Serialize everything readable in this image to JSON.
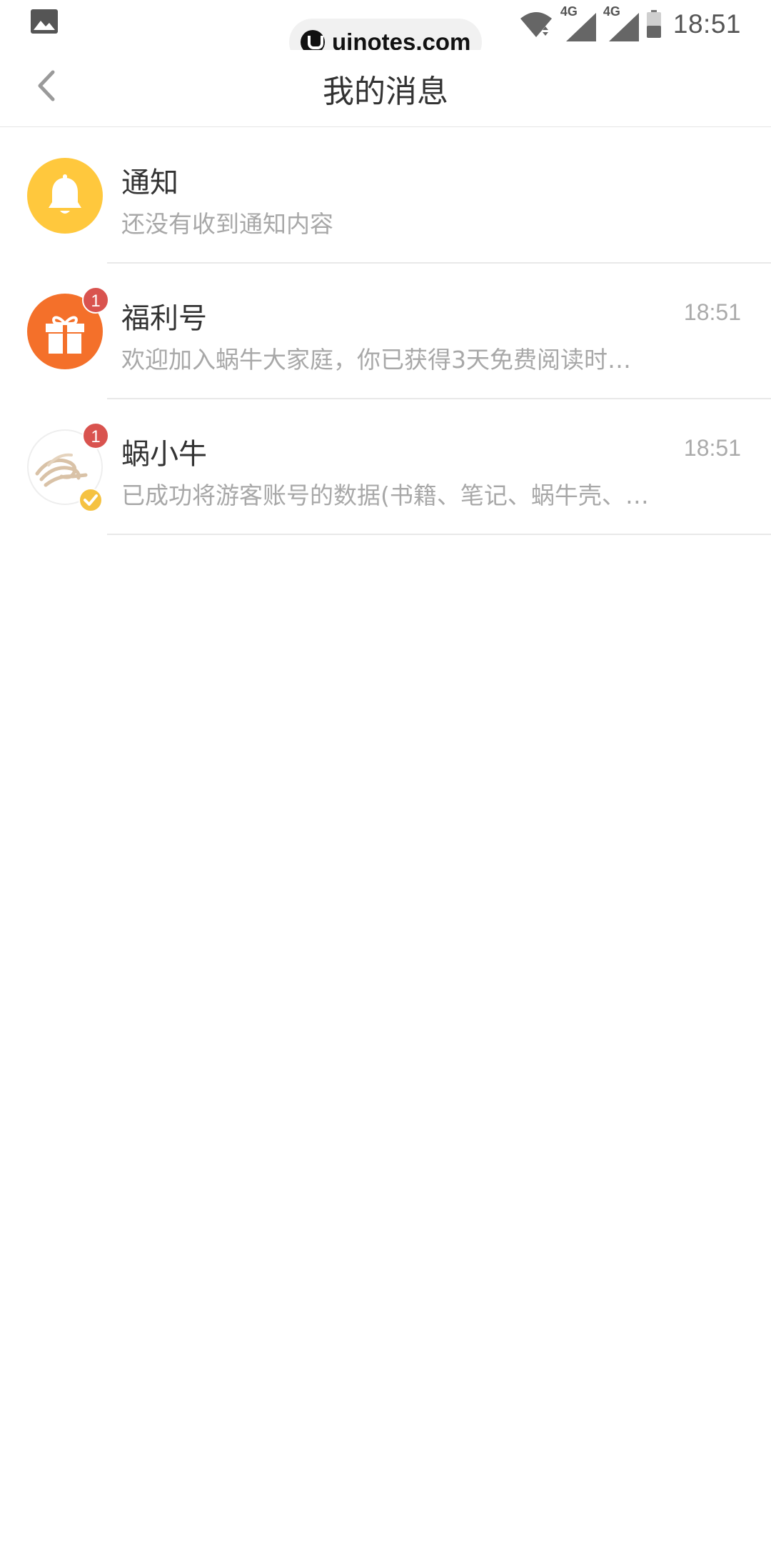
{
  "status_bar": {
    "time": "18:51",
    "signal_1_label": "4G",
    "signal_2_label": "4G",
    "icons": [
      "gallery-icon",
      "wifi-icon",
      "signal-icon",
      "signal-icon",
      "battery-icon"
    ]
  },
  "watermark": {
    "text": "uinotes.com"
  },
  "header": {
    "title": "我的消息",
    "back_icon": "chevron-left-icon"
  },
  "messages": [
    {
      "name": "通知",
      "preview": "还没有收到通知内容",
      "time": "",
      "badge": "",
      "icon": "bell-icon",
      "avatar_color": "#FFC83D"
    },
    {
      "name": "福利号",
      "preview": "欢迎加入蜗牛大家庭，你已获得3天免费阅读时…",
      "time": "18:51",
      "badge": "1",
      "icon": "gift-icon",
      "avatar_color": "#F4702A"
    },
    {
      "name": "蜗小牛",
      "preview": "已成功将游客账号的数据(书籍、笔记、蜗牛壳、…",
      "time": "18:51",
      "badge": "1",
      "icon": "snail-icon",
      "avatar_color": "#FFFFFF"
    }
  ],
  "colors": {
    "badge": "#D9534F",
    "verified": "#F5C242"
  }
}
